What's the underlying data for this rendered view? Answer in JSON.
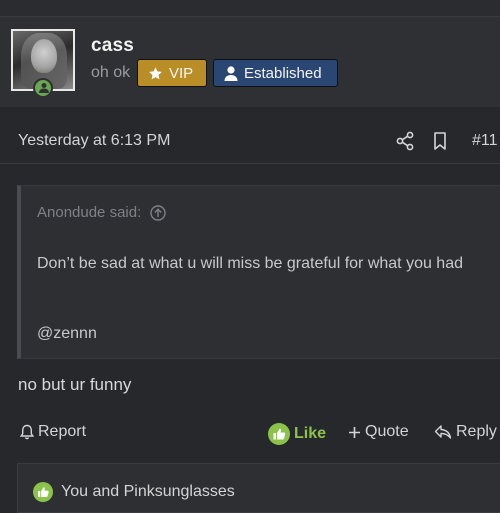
{
  "user": {
    "name": "cass",
    "title": "oh ok",
    "badges": [
      {
        "label": "VIP",
        "icon": "star-icon",
        "color": "#b98e27"
      },
      {
        "label": "Established",
        "icon": "user-icon",
        "color": "#2a4673"
      }
    ],
    "status_color": "#6aa84f"
  },
  "post": {
    "timestamp": "Yesterday at 6:13 PM",
    "number": "#11",
    "quote": {
      "author_line": "Anondude said:",
      "body": "Don’t be sad at what u will miss be grateful for what you had",
      "mention": "@zennn"
    },
    "message": "no but ur funny"
  },
  "actions": {
    "report": "Report",
    "like": "Like",
    "quote": "Quote",
    "reply": "Reply"
  },
  "likes": {
    "text": "You and Pinksunglasses"
  },
  "colors": {
    "like_green": "#8bc34a",
    "background": "#27282c"
  }
}
